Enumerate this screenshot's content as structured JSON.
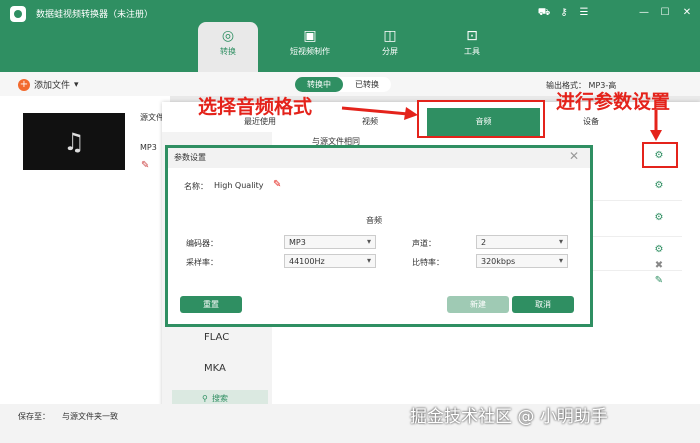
{
  "app": {
    "title": "数据蛙视频转换器（未注册）"
  },
  "nav": [
    {
      "label": "转换",
      "icon": "convert-icon",
      "glyph": "◎"
    },
    {
      "label": "短视频制作",
      "icon": "tv-icon",
      "glyph": "▣"
    },
    {
      "label": "分屏",
      "icon": "split-screen-icon",
      "glyph": "◫"
    },
    {
      "label": "工具",
      "icon": "toolbox-icon",
      "glyph": "⊡"
    }
  ],
  "toolbar": {
    "add_file": "添加文件",
    "converting": "转换中",
    "converted": "已转换",
    "output_format": "输出格式：",
    "output_value": "MP3-高"
  },
  "file": {
    "source": "源文件",
    "format": "MP3"
  },
  "panel": {
    "tabs": [
      "最近使用",
      "视频",
      "音频",
      "设备"
    ],
    "same_as_source": "与源文件相同",
    "formats": [
      "FLAC",
      "MKA"
    ],
    "search": "搜索"
  },
  "dialog": {
    "title": "参数设置",
    "name_label": "名称：",
    "name_value": "High Quality",
    "section": "音频",
    "encoder_label": "编码器：",
    "encoder_value": "MP3",
    "channel_label": "声道：",
    "channel_value": "2",
    "samplerate_label": "采样率：",
    "samplerate_value": "44100Hz",
    "bitrate_label": "比特率：",
    "bitrate_value": "320kbps",
    "reset": "重置",
    "create": "新建",
    "cancel": "取消"
  },
  "bottom": {
    "save_to": "保存至：",
    "save_path": "与源文件夹一致"
  },
  "annotations": {
    "select_format": "选择音频格式",
    "set_params": "进行参数设置"
  },
  "watermark": "掘金技术社区 @ 小明助手",
  "colors": {
    "primary": "#2f8f62",
    "accent": "#f26a2e",
    "annotation": "#e4231b"
  }
}
